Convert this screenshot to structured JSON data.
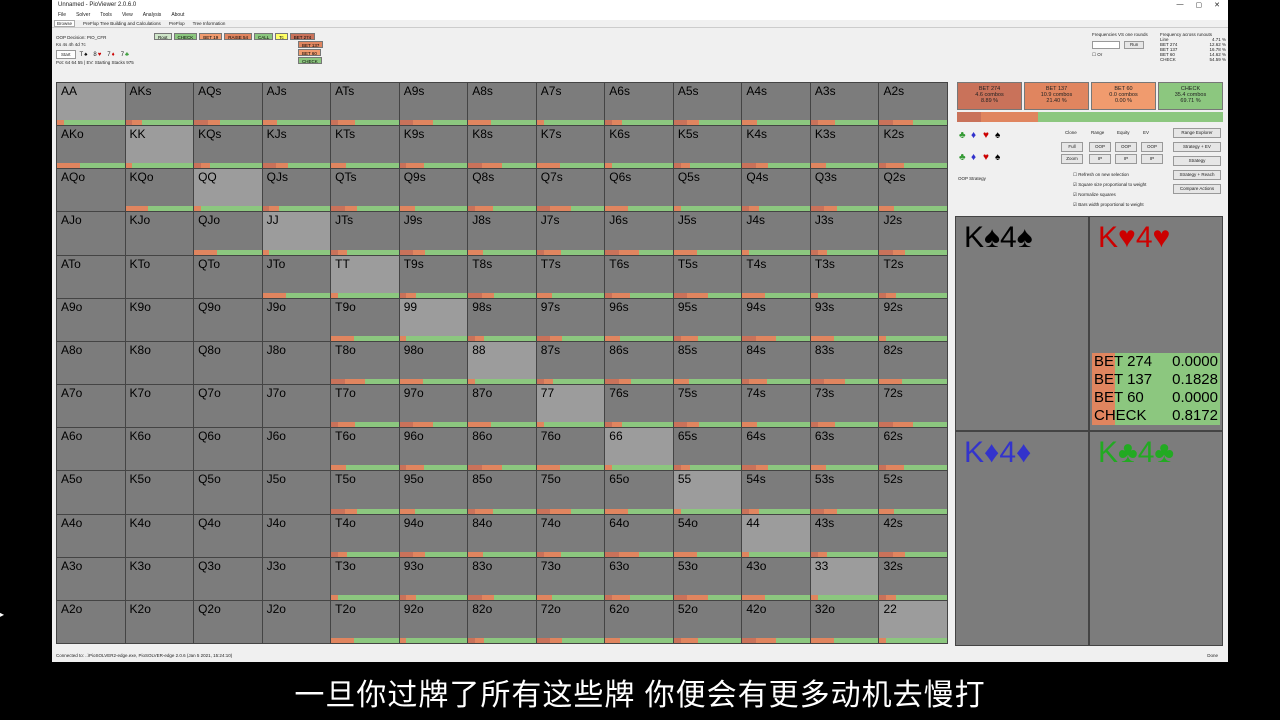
{
  "window": {
    "title": "Unnamed - PioViewer 2.0.6.0"
  },
  "menu": [
    "File",
    "Solver",
    "Tools",
    "View",
    "Analysis",
    "About"
  ],
  "tabs": [
    "Browse",
    "PreFlop Tree Building and Calculations",
    "PreFlop",
    "Tree Information"
  ],
  "info": {
    "decision": "OOP Decision: PIO_CFR",
    "board": "Ks 4s 4h 4d 7c",
    "start_label": "Start",
    "pot_line": "Pot: 64 64 55 | EV: Starting Stacks 975"
  },
  "board_cards": [
    {
      "r": "T",
      "s": "♠",
      "c": "#000"
    },
    {
      "r": "8",
      "s": "♥",
      "c": "#c00"
    },
    {
      "r": "7",
      "s": "♦",
      "c": "#c00"
    },
    {
      "r": "7",
      "s": "♣",
      "c": "#393"
    }
  ],
  "tree": {
    "root": "Root",
    "check": "CHECK",
    "bet19": "BET 19",
    "raise": "RAISE 54",
    "call": "CALL",
    "tc": "Tc",
    "bet274": "BET 274",
    "bet137": "BET 137",
    "bet60": "BET 60",
    "check2": "CHECK"
  },
  "freq": {
    "title": "Frequencies VS one rounds",
    "run": "Run",
    "title2": "Frequency across runouts",
    "line": "Line",
    "line_val": "4.71 %",
    "items": [
      [
        "BET 274",
        "12.62 %"
      ],
      [
        "BET 137",
        "16.78 %"
      ],
      [
        "BET 60",
        "14.62 %"
      ],
      [
        "CHECK",
        "54.59 %"
      ]
    ]
  },
  "grid": {
    "rows": [
      [
        "AA",
        "AKs",
        "AQs",
        "AJs",
        "ATs",
        "A9s",
        "A8s",
        "A7s",
        "A6s",
        "A5s",
        "A4s",
        "A3s",
        "A2s"
      ],
      [
        "AKo",
        "KK",
        "KQs",
        "KJs",
        "KTs",
        "K9s",
        "K8s",
        "K7s",
        "K6s",
        "K5s",
        "K4s",
        "K3s",
        "K2s"
      ],
      [
        "AQo",
        "KQo",
        "QQ",
        "QJs",
        "QTs",
        "Q9s",
        "Q8s",
        "Q7s",
        "Q6s",
        "Q5s",
        "Q4s",
        "Q3s",
        "Q2s"
      ],
      [
        "AJo",
        "KJo",
        "QJo",
        "JJ",
        "JTs",
        "J9s",
        "J8s",
        "J7s",
        "J6s",
        "J5s",
        "J4s",
        "J3s",
        "J2s"
      ],
      [
        "ATo",
        "KTo",
        "QTo",
        "JTo",
        "TT",
        "T9s",
        "T8s",
        "T7s",
        "T6s",
        "T5s",
        "T4s",
        "T3s",
        "T2s"
      ],
      [
        "A9o",
        "K9o",
        "Q9o",
        "J9o",
        "T9o",
        "99",
        "98s",
        "97s",
        "96s",
        "95s",
        "94s",
        "93s",
        "92s"
      ],
      [
        "A8o",
        "K8o",
        "Q8o",
        "J8o",
        "T8o",
        "98o",
        "88",
        "87s",
        "86s",
        "85s",
        "84s",
        "83s",
        "82s"
      ],
      [
        "A7o",
        "K7o",
        "Q7o",
        "J7o",
        "T7o",
        "97o",
        "87o",
        "77",
        "76s",
        "75s",
        "74s",
        "73s",
        "72s"
      ],
      [
        "A6o",
        "K6o",
        "Q6o",
        "J6o",
        "T6o",
        "96o",
        "86o",
        "76o",
        "66",
        "65s",
        "64s",
        "63s",
        "62s"
      ],
      [
        "A5o",
        "K5o",
        "Q5o",
        "J5o",
        "T5o",
        "95o",
        "85o",
        "75o",
        "65o",
        "55",
        "54s",
        "53s",
        "52s"
      ],
      [
        "A4o",
        "K4o",
        "Q4o",
        "J4o",
        "T4o",
        "94o",
        "84o",
        "74o",
        "64o",
        "54o",
        "44",
        "43s",
        "42s"
      ],
      [
        "A3o",
        "K3o",
        "Q3o",
        "J3o",
        "T3o",
        "93o",
        "83o",
        "73o",
        "63o",
        "53o",
        "43o",
        "33",
        "32s"
      ],
      [
        "A2o",
        "K2o",
        "Q2o",
        "J2o",
        "T2o",
        "92o",
        "82o",
        "72o",
        "62o",
        "52o",
        "42o",
        "32o",
        "22"
      ]
    ]
  },
  "summary": [
    {
      "name": "BET 274",
      "combos": "4.6 combos",
      "pct": "8.89 %",
      "color": "#c9725a"
    },
    {
      "name": "BET 137",
      "combos": "10.9 combos",
      "pct": "21.40 %",
      "color": "#e0855f"
    },
    {
      "name": "BET 60",
      "combos": "0.0 combos",
      "pct": "0.00 %",
      "color": "#f09b6e"
    },
    {
      "name": "CHECK",
      "combos": "35.4 combos",
      "pct": "69.71 %",
      "color": "#8cc77f"
    }
  ],
  "controls": {
    "clone": "Clone",
    "range": "Range",
    "equity": "Equity",
    "ev": "EV",
    "full": "Full",
    "zoom": "Zoom",
    "oop": "OOP",
    "ip": "IP",
    "range_explorer": "Range Explorer",
    "strategy_ev": "Strategy + EV",
    "strategy": "Strategy",
    "strategy_reach": "Strategy + Reach",
    "compare": "Compare Actions",
    "oop_strategy": "OOP Strategy",
    "checks": [
      "Refresh on new selection",
      "Square size proportional to weight",
      "Normalize squares",
      "Bars width proportional to weight"
    ]
  },
  "cards": [
    {
      "label": "K♠4♠",
      "color": "#000"
    },
    {
      "label": "K♥4♥",
      "color": "#c00"
    },
    {
      "label": "K♦4♦",
      "color": "#33c"
    },
    {
      "label": "K♣4♣",
      "color": "#2a2"
    }
  ],
  "hand_stats": [
    [
      "BET 274",
      "0.0000"
    ],
    [
      "BET 137",
      "0.1828"
    ],
    [
      "BET 60",
      "0.0000"
    ],
    [
      "CHECK",
      "0.8172"
    ]
  ],
  "status": {
    "left": "Connected to: ..\\PioSOLVER2-edge.exe, PioSOLVER-edge 2.0.6 (Jan 5 2021, 15:24:10)",
    "right": "Done"
  },
  "subtitle": "一旦你过牌了所有这些牌 你便会有更多动机去慢打"
}
